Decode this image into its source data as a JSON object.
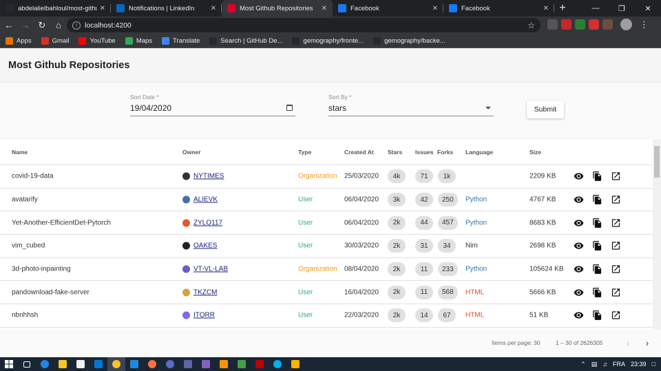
{
  "browser": {
    "tabs": [
      {
        "title": "abdelalielbahloul/most-githu",
        "icon": "github-icon",
        "icon_color": "#24292e",
        "active": false
      },
      {
        "title": "Notifications | LinkedIn",
        "icon": "linkedin-icon",
        "icon_color": "#0a66c2",
        "active": false
      },
      {
        "title": "Most Github Repositories",
        "icon": "angular-icon",
        "icon_color": "#dd0031",
        "active": true
      },
      {
        "title": "Facebook",
        "icon": "facebook-icon",
        "icon_color": "#1877f2",
        "active": false
      },
      {
        "title": "Facebook",
        "icon": "facebook-icon",
        "icon_color": "#1877f2",
        "active": false
      }
    ],
    "address": "localhost:4200",
    "bookmarks": [
      {
        "label": "Apps",
        "icon": "apps-grid-icon",
        "color": "#e37400"
      },
      {
        "label": "Gmail",
        "icon": "gmail-icon",
        "color": "#d93025"
      },
      {
        "label": "YouTube",
        "icon": "youtube-icon",
        "color": "#ff0000"
      },
      {
        "label": "Maps",
        "icon": "maps-icon",
        "color": "#34a853"
      },
      {
        "label": "Translate",
        "icon": "translate-icon",
        "color": "#4285f4"
      },
      {
        "label": "Search | GitHub De...",
        "icon": "github-icon",
        "color": "#24292e"
      },
      {
        "label": "gemography/fronte...",
        "icon": "github-icon",
        "color": "#24292e"
      },
      {
        "label": "gemography/backe...",
        "icon": "github-icon",
        "color": "#24292e"
      }
    ]
  },
  "app": {
    "title": "Most Github Repositories"
  },
  "form": {
    "sort_date_label": "Sort Date *",
    "sort_date_value": "19/04/2020",
    "sort_by_label": "Sort By *",
    "sort_by_value": "stars",
    "submit_label": "Submit"
  },
  "table": {
    "columns": {
      "name": "Name",
      "owner": "Owner",
      "type": "Type",
      "created": "Created At",
      "stars": "Stars",
      "issues": "Issues",
      "forks": "Forks",
      "language": "Language",
      "size": "Size"
    },
    "rows": [
      {
        "name": "covid-19-data",
        "owner": "NYTIMES",
        "avatar_color": "#333333",
        "type": "Organization",
        "created": "25/03/2020",
        "stars": "4k",
        "issues": "71",
        "forks": "1k",
        "language": "",
        "language_color": "#3572A5",
        "size": "2209 KB"
      },
      {
        "name": "avatarify",
        "owner": "ALIEVK",
        "avatar_color": "#4a6fa5",
        "type": "User",
        "created": "06/04/2020",
        "stars": "3k",
        "issues": "42",
        "forks": "250",
        "language": "Python",
        "language_color": "#3572A5",
        "size": "4767 KB"
      },
      {
        "name": "Yet-Another-EfficientDet-Pytorch",
        "owner": "ZYLO117",
        "avatar_color": "#e4572e",
        "type": "User",
        "created": "06/04/2020",
        "stars": "2k",
        "issues": "44",
        "forks": "457",
        "language": "Python",
        "language_color": "#3572A5",
        "size": "8683 KB"
      },
      {
        "name": "vim_cubed",
        "owner": "OAKES",
        "avatar_color": "#222222",
        "type": "User",
        "created": "30/03/2020",
        "stars": "2k",
        "issues": "31",
        "forks": "34",
        "language": "Nim",
        "language_color": "#333333",
        "size": "2698 KB"
      },
      {
        "name": "3d-photo-inpainting",
        "owner": "VT-VL-LAB",
        "avatar_color": "#6a5acd",
        "type": "Organization",
        "created": "08/04/2020",
        "stars": "2k",
        "issues": "11",
        "forks": "233",
        "language": "Python",
        "language_color": "#3572A5",
        "size": "105624 KB"
      },
      {
        "name": "pandownload-fake-server",
        "owner": "TKZCM",
        "avatar_color": "#d9a13b",
        "type": "User",
        "created": "16/04/2020",
        "stars": "2k",
        "issues": "11",
        "forks": "568",
        "language": "HTML",
        "language_color": "#e34c26",
        "size": "5666 KB"
      },
      {
        "name": "nbnhhsh",
        "owner": "ITORR",
        "avatar_color": "#7b68ee",
        "type": "User",
        "created": "22/03/2020",
        "stars": "2k",
        "issues": "14",
        "forks": "67",
        "language": "HTML",
        "language_color": "#e34c26",
        "size": "51 KB"
      }
    ],
    "type_colors": {
      "Organization": "#f39c12",
      "User": "#26a69a"
    }
  },
  "paginator": {
    "items_per_page_label": "Items per page:",
    "items_per_page_value": "30",
    "range_label": "1 – 30 of 2626305"
  },
  "taskbar": {
    "lang": "FRA",
    "time": "23:39"
  }
}
